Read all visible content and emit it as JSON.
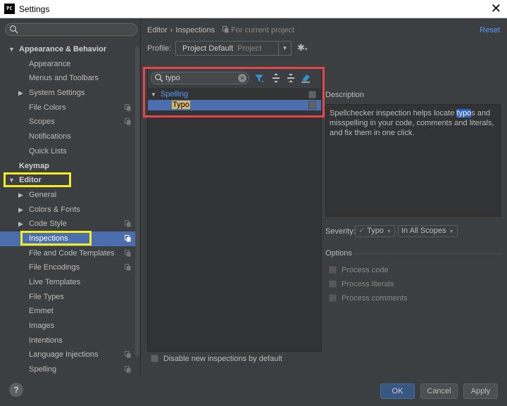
{
  "window": {
    "app_icon": "PC",
    "title": "Settings",
    "close": "✕"
  },
  "sidebar": {
    "search_placeholder": "",
    "items": [
      {
        "label": "Appearance & Behavior",
        "level": 0,
        "arrow": "▼"
      },
      {
        "label": "Appearance",
        "level": 1
      },
      {
        "label": "Menus and Toolbars",
        "level": 1
      },
      {
        "label": "System Settings",
        "level": 1,
        "arrow": "▶"
      },
      {
        "label": "File Colors",
        "level": 1,
        "copy": true
      },
      {
        "label": "Scopes",
        "level": 1,
        "copy": true
      },
      {
        "label": "Notifications",
        "level": 1
      },
      {
        "label": "Quick Lists",
        "level": 1
      },
      {
        "label": "Keymap",
        "level": 0
      },
      {
        "label": "Editor",
        "level": 0,
        "arrow": "▼"
      },
      {
        "label": "General",
        "level": 1,
        "arrow": "▶"
      },
      {
        "label": "Colors & Fonts",
        "level": 1,
        "arrow": "▶"
      },
      {
        "label": "Code Style",
        "level": 1,
        "arrow": "▶",
        "copy": true
      },
      {
        "label": "Inspections",
        "level": 1,
        "copy": true,
        "selected": true
      },
      {
        "label": "File and Code Templates",
        "level": 1,
        "copy": true
      },
      {
        "label": "File Encodings",
        "level": 1,
        "copy": true
      },
      {
        "label": "Live Templates",
        "level": 1
      },
      {
        "label": "File Types",
        "level": 1
      },
      {
        "label": "Emmet",
        "level": 1
      },
      {
        "label": "Images",
        "level": 1
      },
      {
        "label": "Intentions",
        "level": 1
      },
      {
        "label": "Language Injections",
        "level": 1,
        "copy": true
      },
      {
        "label": "Spelling",
        "level": 1,
        "copy": true
      }
    ]
  },
  "header": {
    "crumb_1": "Editor",
    "crumb_sep": "›",
    "crumb_2": "Inspections",
    "note": "For current project",
    "reset": "Reset"
  },
  "profile": {
    "label": "Profile:",
    "value": "Project Default",
    "scope": "Project"
  },
  "inspections": {
    "filter_value": "typo",
    "group": "Spelling",
    "item": "Typo",
    "disable_new": "Disable new inspections by default"
  },
  "description": {
    "label": "Description",
    "text_before": "Spellchecker inspection helps locate ",
    "text_sel": "typo",
    "text_after": "s and misspelling in your code, comments and literals, and fix them in one click."
  },
  "severity": {
    "label": "Severity:",
    "value": "Typo",
    "scope": "In All Scopes"
  },
  "options": {
    "label": "Options",
    "items": [
      "Process code",
      "Process literals",
      "Process comments"
    ]
  },
  "buttons": {
    "help": "?",
    "ok": "OK",
    "cancel": "Cancel",
    "apply": "Apply"
  },
  "colors": {
    "accent": "#4b6eaf",
    "highlight_yellow": "#f4ec1c",
    "highlight_red": "#e8444b",
    "link": "#589df6"
  }
}
